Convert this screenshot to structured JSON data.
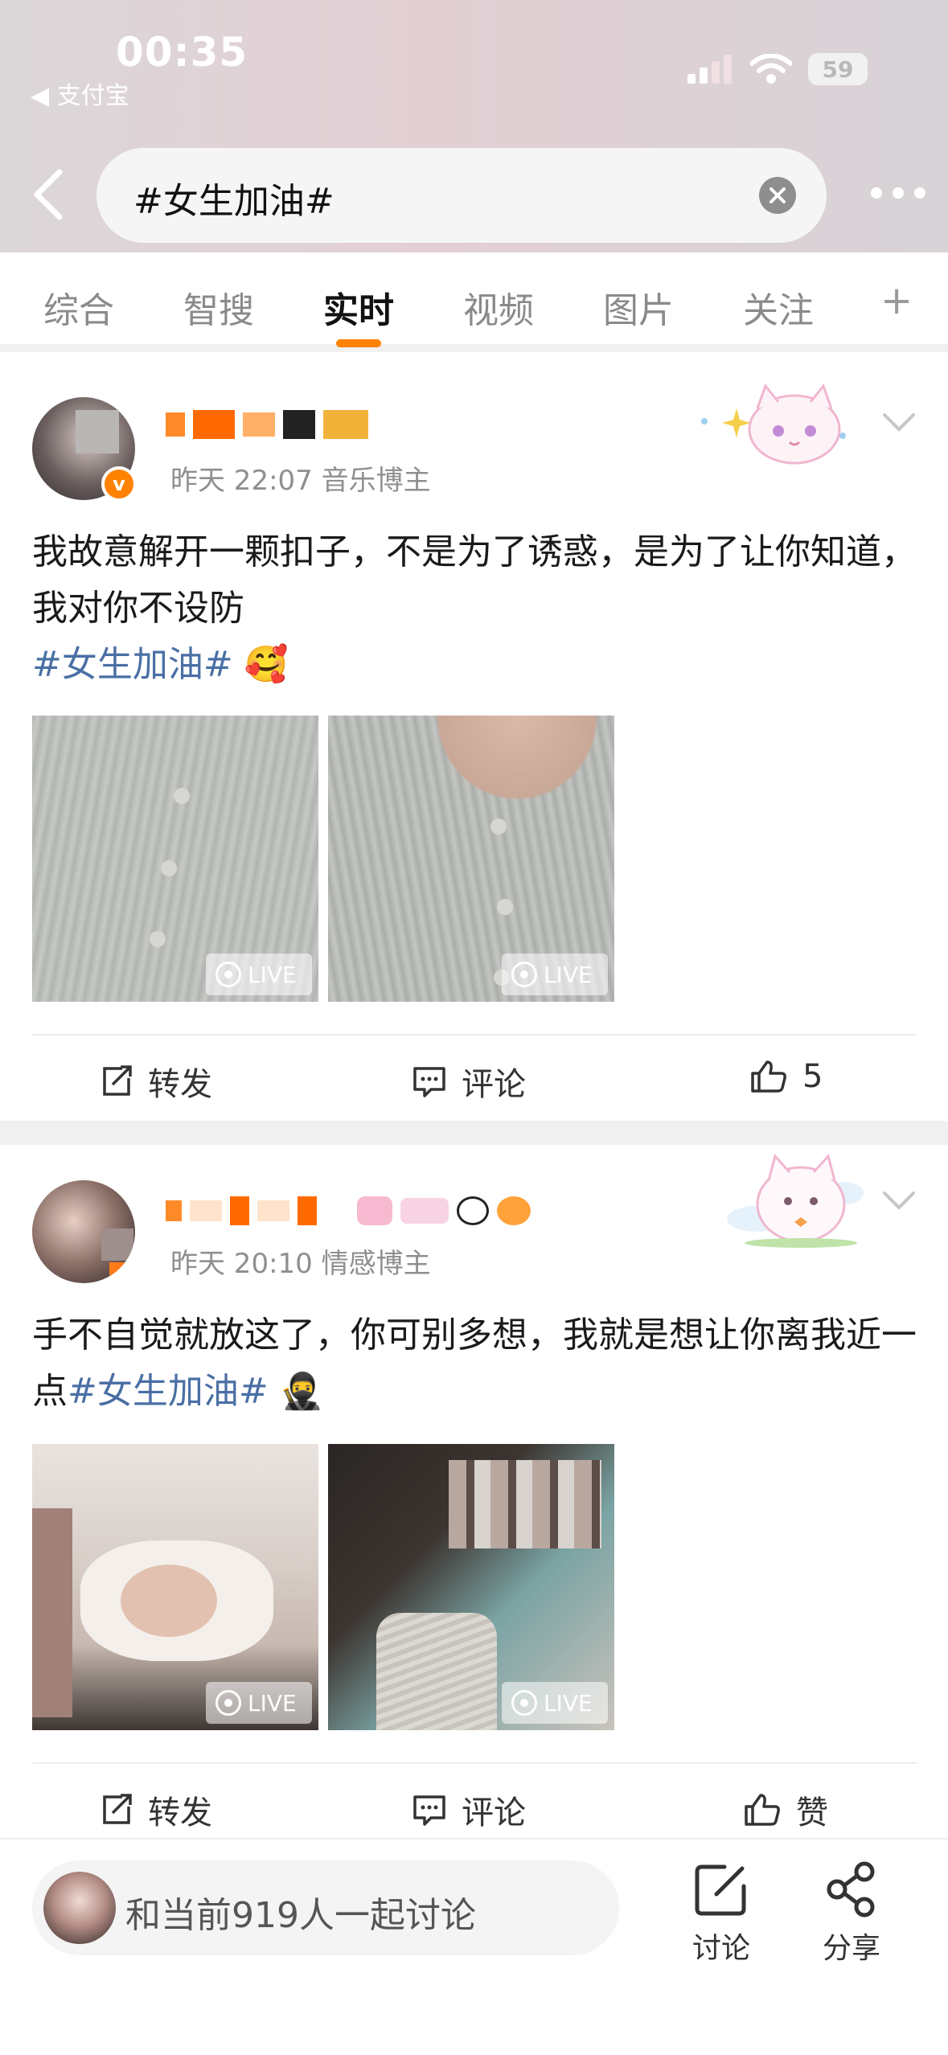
{
  "status_bar": {
    "time": "00:35",
    "back_app": "◀ 支付宝",
    "battery": "59"
  },
  "search": {
    "query": "#女生加油#"
  },
  "tabs": [
    {
      "label": "综合",
      "active": false
    },
    {
      "label": "智搜",
      "active": false
    },
    {
      "label": "实时",
      "active": true
    },
    {
      "label": "视频",
      "active": false
    },
    {
      "label": "图片",
      "active": false
    },
    {
      "label": "关注",
      "active": false
    }
  ],
  "tab_add": "+",
  "posts": [
    {
      "meta": "昨天 22:07  音乐博主",
      "text": "我故意解开一颗扣子，不是为了诱惑，是为了让你知道，我对你不设防",
      "hashtag": "#女生加油#",
      "emoji": "🥰",
      "live_label": "LIVE",
      "repost": "转发",
      "comment": "评论",
      "likes": "5"
    },
    {
      "meta": "昨天 20:10  情感博主",
      "text": "手不自觉就放这了，你可别多想，我就是想让你离我近一点",
      "hashtag": "#女生加油#",
      "emoji": "🥷",
      "live_label": "LIVE",
      "repost": "转发",
      "comment": "评论",
      "likes": "赞"
    }
  ],
  "bottom_bar": {
    "discuss_prompt": "和当前919人一起讨论",
    "discuss_label": "讨论",
    "share_label": "分享"
  },
  "colors": {
    "accent": "#ff8200",
    "hashtag": "#4a6fa5",
    "header_tint": "#e2cfd4"
  }
}
